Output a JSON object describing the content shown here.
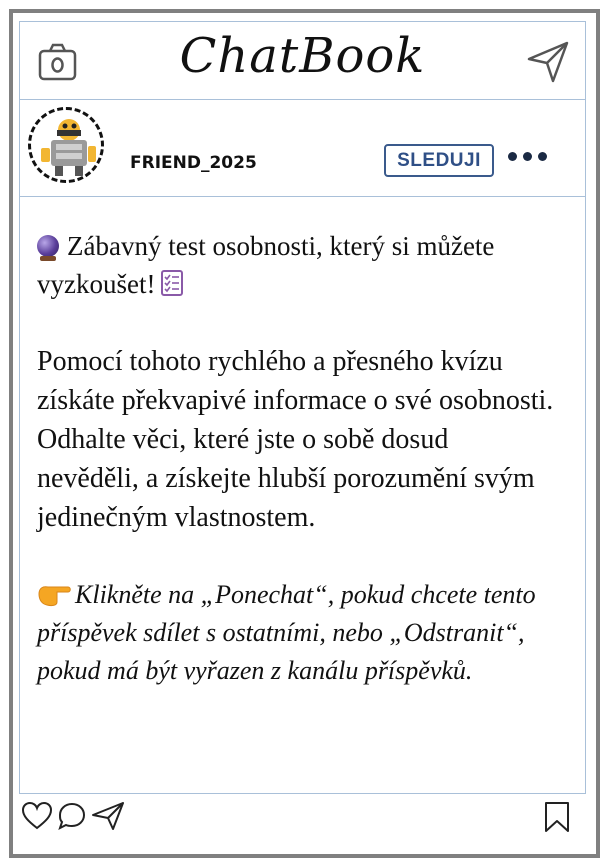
{
  "header": {
    "app_title": "ChatBook",
    "camera_icon": "camera-icon",
    "send_icon": "paper-plane-icon"
  },
  "profile": {
    "username": "FRIEND_2025",
    "follow_label": "SLEDUJI",
    "more_icon": "more-dots-icon",
    "avatar": "robot-avatar"
  },
  "post": {
    "intro": "Zábavný test osobnosti, který si můžete vyzkoušet!",
    "intro_emoji_start": "crystal-ball-icon",
    "intro_emoji_end": "checklist-icon",
    "body": "Pomocí tohoto rychlého a přesného kvízu získáte překvapivé informace o své osobnosti. Odhalte věci, které jste o sobě dosud nevěděli, a získejte hlubší porozumění svým jedinečným vlastnostem.",
    "cta_emoji": "pointing-hand-icon",
    "cta": "Klikněte na „Ponechat“, pokud chcete tento příspěvek sdílet s ostatními, nebo „Odstranit“, pokud má být vyřazen z kanálu příspěvků."
  },
  "actions": {
    "like_icon": "heart-icon",
    "comment_icon": "comment-icon",
    "share_icon": "paper-plane-icon",
    "save_icon": "bookmark-icon"
  },
  "colors": {
    "frame": "#808080",
    "divider": "#a9c0d9",
    "follow_accent": "#2f4f86"
  }
}
